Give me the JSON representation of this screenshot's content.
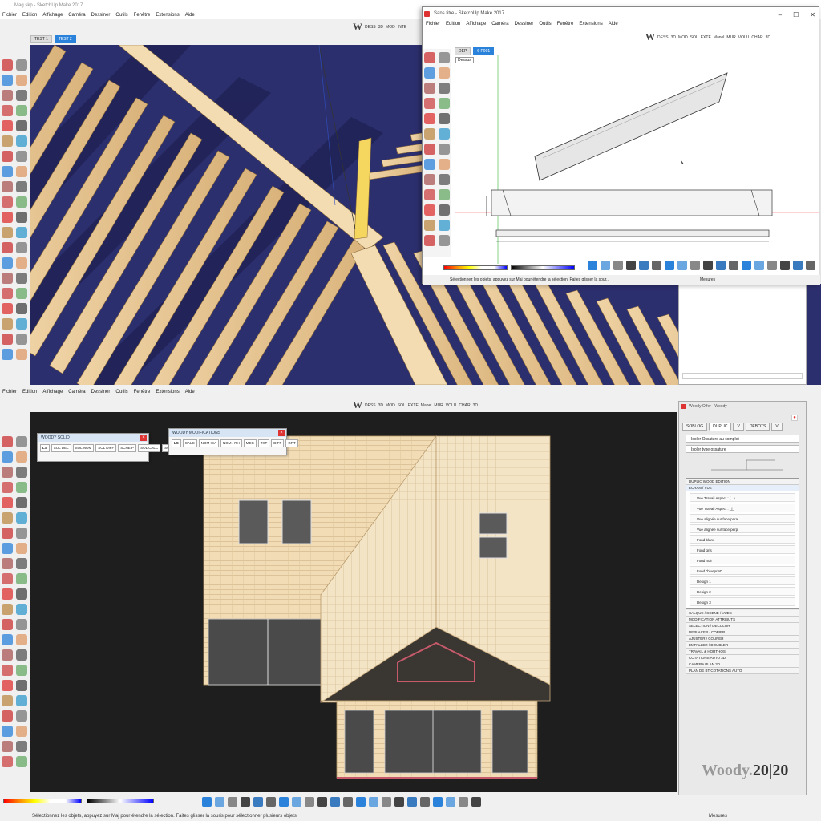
{
  "top": {
    "window_title": "Mag.skp - SketchUp Make 2017",
    "menu": [
      "Fichier",
      "Edition",
      "Affichage",
      "Caméra",
      "Dessiner",
      "Outils",
      "Fenêtre",
      "Extensions",
      "Aide"
    ],
    "tabs": [
      "TEST 1",
      "TEST 2"
    ],
    "woody_toolbar": [
      "DESS",
      "3D",
      "MOD",
      "INTE"
    ]
  },
  "sub_window": {
    "title": "Sans titre - SketchUp Make 2017",
    "menu": [
      "Fichier",
      "Edition",
      "Affichage",
      "Caméra",
      "Dessiner",
      "Outils",
      "Fenêtre",
      "Extensions",
      "Aide"
    ],
    "tabs": [
      "DEP",
      "6 P001"
    ],
    "woody_toolbar": [
      "DESS",
      "3D",
      "MOD",
      "SOL",
      "EXTE",
      "Manel",
      "MUR",
      "VOLU",
      "CHAR",
      "3D"
    ],
    "scene_label": "Dessus",
    "status_text": "Sélectionnez les objets, appuyez sur Maj pour étendre la sélection. Faites glisser la sour...",
    "measure_label": "Mesures"
  },
  "bottom": {
    "menu": [
      "Fichier",
      "Edition",
      "Affichage",
      "Caméra",
      "Dessiner",
      "Outils",
      "Fenêtre",
      "Extensions",
      "Aide"
    ],
    "woody_toolbar": [
      "DESS",
      "3D",
      "MOD",
      "SOL",
      "EXTE",
      "Manel",
      "MUR",
      "VOLU",
      "CHAR",
      "3D"
    ],
    "status_text": "Sélectionnez les objets, appuyez sur Maj pour étendre la sélection. Faites glisser la souris pour sélectionner plusieurs objets.",
    "measure_label": "Mesures"
  },
  "float_solid": {
    "title": "WOODY SOLID",
    "buttons": [
      "SOL DEL",
      "SOL NOM",
      "SOL DIFF",
      "SCHE P",
      "SOL CALC",
      "SCHE CALC"
    ]
  },
  "float_modif": {
    "title": "WOODY MODIFICATIONS",
    "buttons": [
      "CALC",
      "NOM ICA",
      "NOM / RH",
      "MEC",
      "TXT",
      "DIFF",
      "GRT"
    ]
  },
  "woody_panel": {
    "title": "Woody Offer - Woody",
    "tabs": [
      "SOBLOG",
      "DUPLIC",
      "V",
      "DEBOTS",
      "V"
    ],
    "top_buttons": [
      "Isoler Ossature au complet",
      "Isoler type ossature"
    ],
    "list_header": "DUPLIC WOOD EDITION",
    "list_sub": "ECRAN / VUE",
    "items": [
      "Vue Travail Aspect : (...)",
      "Vue Travail Aspect : _|_",
      "Vue alignée sur face/para",
      "Vue alignée sur face/perp",
      "Fond blanc",
      "Fond gris",
      "Fond noir",
      "Fond \"blueprint\"",
      "Design 1",
      "Design 2",
      "Design 3"
    ],
    "sections": [
      "CALQUE / SCENE / VUES",
      "MODIFICATION ATTRIBUTS",
      "SELECTION / DECOLOR",
      "DEPLACER / COPIER",
      "AJUSTER / COUPER",
      "EMPALLER / DOUBLER",
      "TRAVAIL & HORTHOS",
      "COTATIONS AUTO 3D",
      "CAMERA PLAN 3D",
      "PLAN DE BT COTATIONS AUTO"
    ],
    "logo_text": "Woody.",
    "logo_num": "20|20"
  },
  "colors": {
    "accent": "#2a82da",
    "wood": "#e8c89a",
    "navy": "#2c2f6e",
    "dark_bg": "#1e1e1e"
  }
}
